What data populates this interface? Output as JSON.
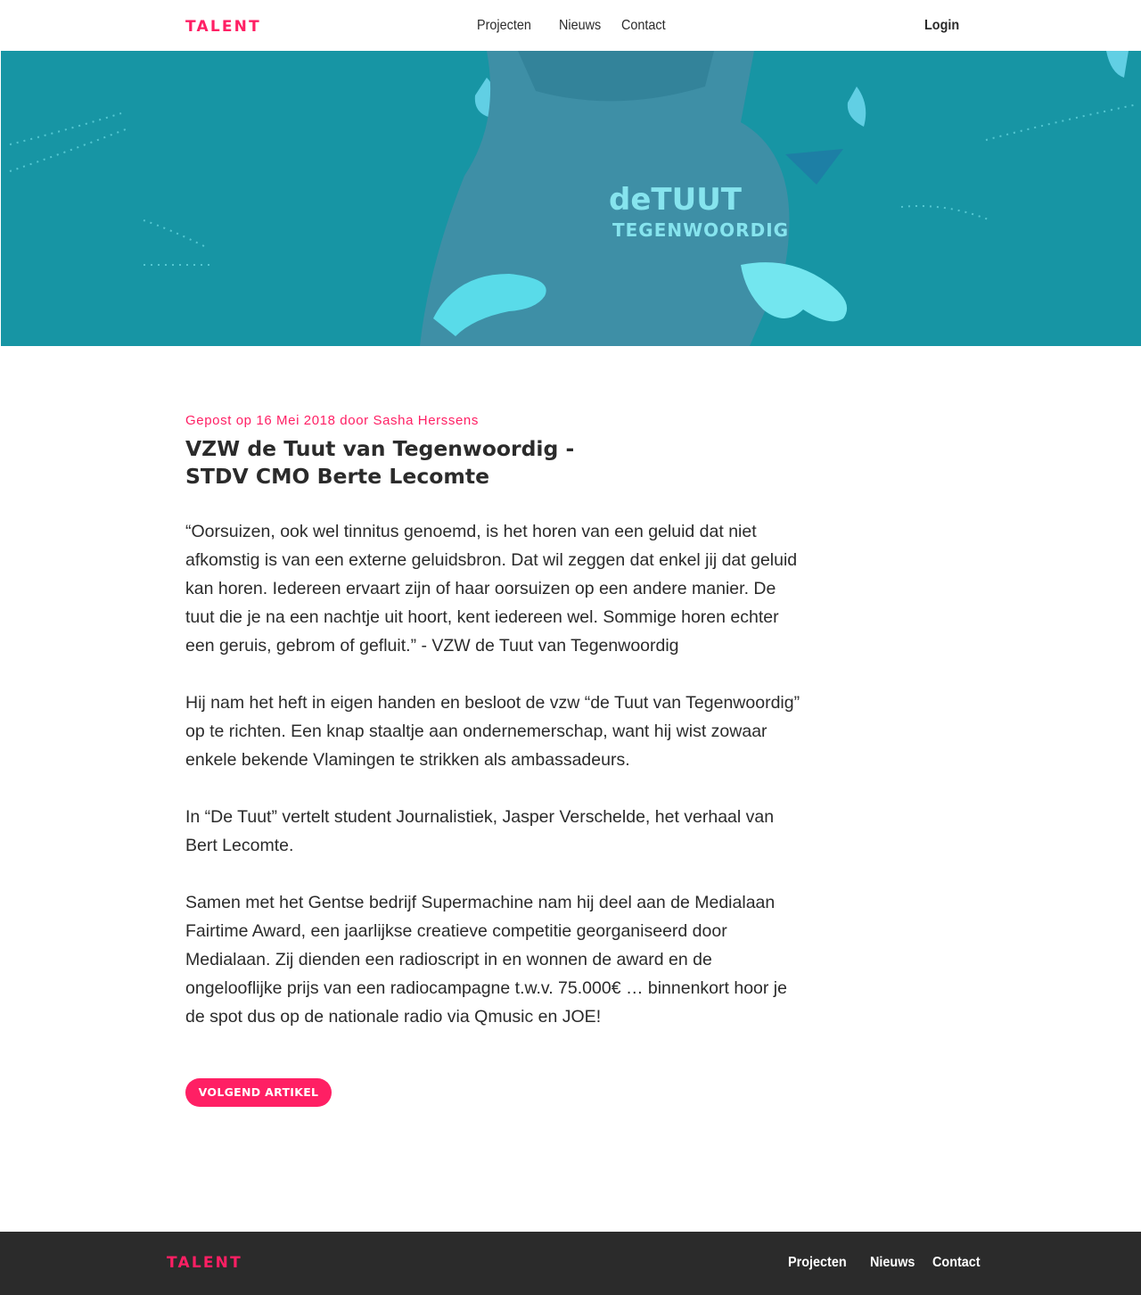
{
  "brand": {
    "name": "TALENT",
    "accent_color": "#ff1f64",
    "dark_color": "#2b2b2b",
    "hero_color": "#1795a4"
  },
  "header": {
    "nav": [
      {
        "label": "Projecten"
      },
      {
        "label": "Nieuws"
      },
      {
        "label": "Contact"
      }
    ],
    "login_label": "Login"
  },
  "hero": {
    "image_text_line1": "deTUUT",
    "image_text_line2": "TEGENWOORDIG"
  },
  "article": {
    "meta": "Gepost op 16 Mei 2018 door Sasha Herssens",
    "title": "VZW de Tuut van Tegenwoordig - STDV CMO Berte Lecomte",
    "paragraphs": [
      "“Oorsuizen, ook wel tinnitus genoemd, is het horen van een geluid dat niet afkomstig is van een externe geluidsbron. Dat wil zeggen dat enkel jij dat geluid kan horen. Iedereen ervaart zijn of haar oorsuizen op een andere manier. De tuut die je na een nachtje uit hoort, kent iedereen wel. Sommige horen echter een geruis, gebrom of gefluit.” - VZW de Tuut van Tegenwoordig",
      "Hij nam het heft in eigen handen en besloot de vzw “de Tuut van Tegenwoordig” op te richten. Een knap staaltje aan ondernemerschap, want hij wist zowaar enkele bekende Vlamingen te strikken als ambassadeurs.",
      "In “De Tuut” vertelt student Journalistiek, Jasper Verschelde, het verhaal van Bert Lecomte.",
      "Samen met het Gentse bedrijf Supermachine nam hij deel aan de Medialaan Fairtime Award, een jaarlijkse creatieve competitie georganiseerd door Medialaan. Zij dienden een radioscript in en wonnen de award en de ongelooflijke prijs van een radiocampagne t.w.v. 75.000€ … binnenkort hoor je de spot dus op de nationale radio via Qmusic en JOE!"
    ],
    "next_button_label": "VOLGEND ARTIKEL"
  },
  "footer": {
    "nav": [
      {
        "label": "Projecten"
      },
      {
        "label": "Nieuws"
      },
      {
        "label": "Contact"
      }
    ]
  }
}
